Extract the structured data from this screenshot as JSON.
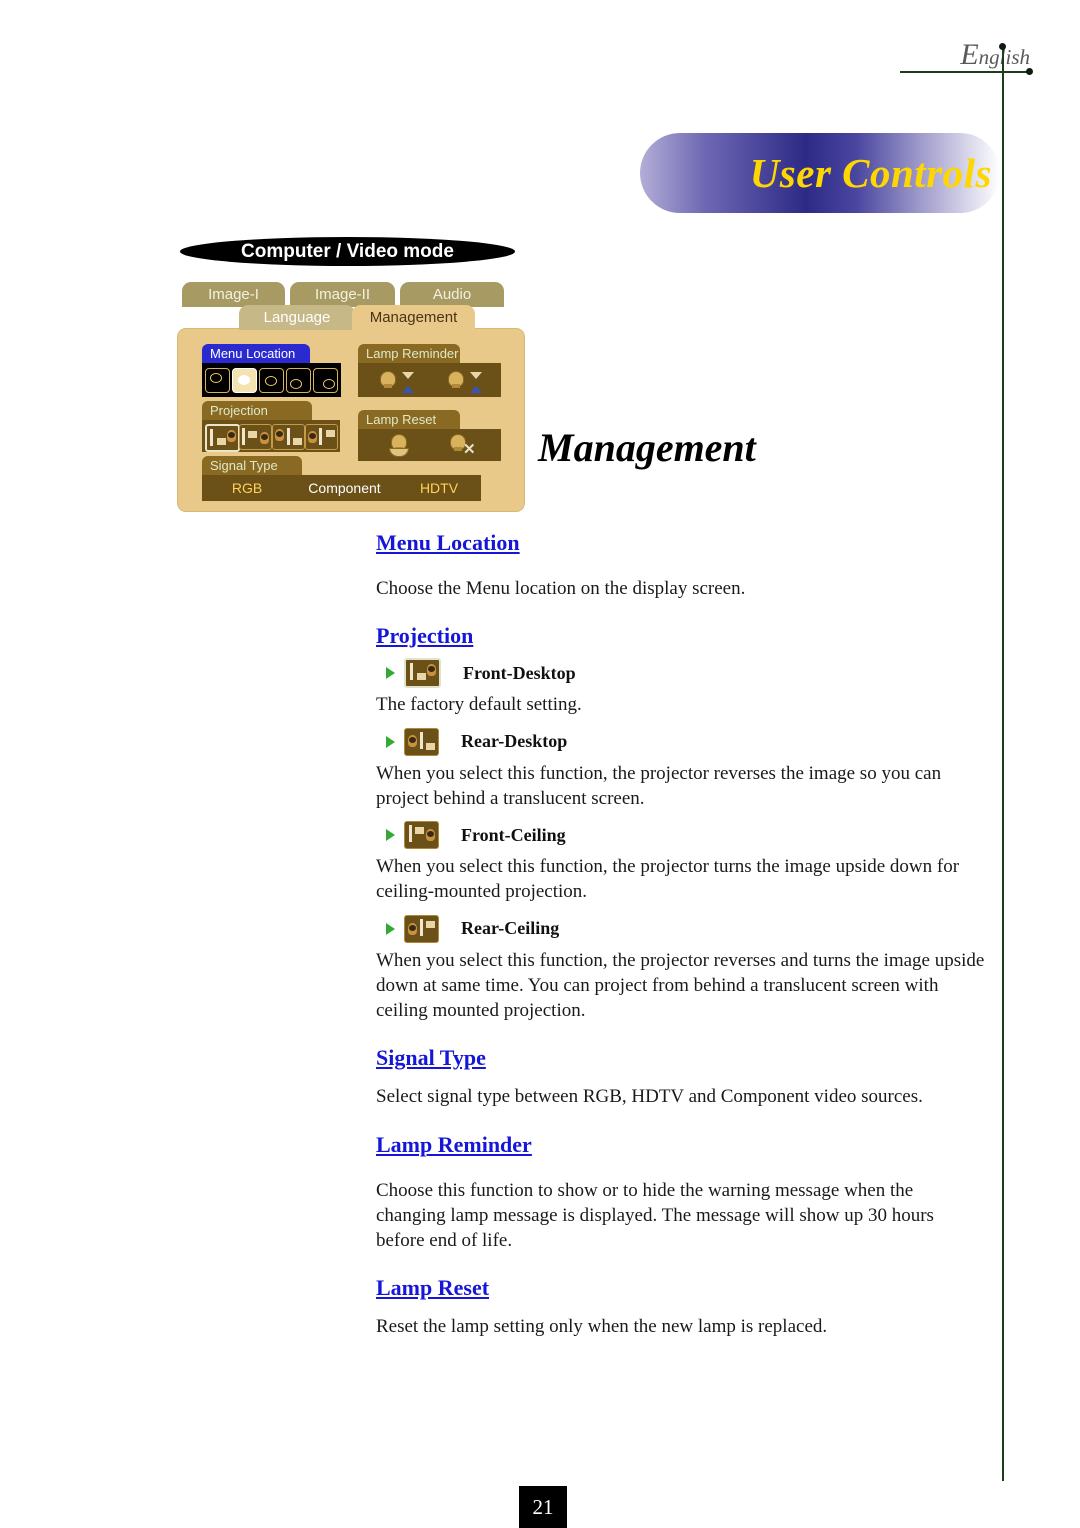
{
  "header": {
    "language_mark_big": "E",
    "language_mark_small": "nglish",
    "banner_title": "User Controls",
    "mode_banner": "Computer / Video mode"
  },
  "osd": {
    "tabs": [
      {
        "label": "Image-I",
        "state": "inactive"
      },
      {
        "label": "Image-II",
        "state": "inactive"
      },
      {
        "label": "Audio",
        "state": "inactive"
      },
      {
        "label": "Language",
        "state": "semi"
      },
      {
        "label": "Management",
        "state": "active"
      }
    ],
    "sections": {
      "menu_location": "Menu Location",
      "projection": "Projection",
      "signal_type": "Signal Type",
      "lamp_reminder": "Lamp Reminder",
      "lamp_reset": "Lamp Reset"
    },
    "signal_options": [
      {
        "label": "RGB",
        "selected": true
      },
      {
        "label": "Component",
        "selected": false
      },
      {
        "label": "HDTV",
        "selected": true
      }
    ]
  },
  "page_title": "Management",
  "sections": {
    "menu_location": {
      "heading": "Menu Location",
      "body": "Choose the Menu location on the display screen."
    },
    "projection": {
      "heading": "Projection",
      "options": [
        {
          "label": "Front-Desktop",
          "icon": "front-desktop-icon",
          "selected": true,
          "body": "The factory default setting."
        },
        {
          "label": "Rear-Desktop",
          "icon": "rear-desktop-icon",
          "selected": false,
          "body": "When you select this function, the projector reverses the image so you can project behind a translucent screen."
        },
        {
          "label": "Front-Ceiling",
          "icon": "front-ceiling-icon",
          "selected": false,
          "body": "When you select this function, the projector turns the image upside down for ceiling-mounted projection."
        },
        {
          "label": "Rear-Ceiling",
          "icon": "rear-ceiling-icon",
          "selected": false,
          "body": "When you select this function, the projector reverses and turns the image upside down at same time. You can project from  behind a translucent screen with ceiling mounted projection."
        }
      ]
    },
    "signal_type": {
      "heading": "Signal Type",
      "body": "Select signal type between RGB, HDTV and Component video sources."
    },
    "lamp_reminder": {
      "heading": "Lamp Reminder",
      "body": "Choose this function to show or to hide the warning message when the changing lamp message is displayed.  The message will show up 30 hours before end of life."
    },
    "lamp_reset": {
      "heading": "Lamp Reset",
      "body": "Reset the lamp setting only when the new lamp is replaced."
    }
  },
  "footer": {
    "page_number": "21"
  },
  "colors": {
    "heading_blue": "#1616d8",
    "banner_yellow": "#ffd700",
    "rule_green": "#1d3d1d",
    "osd_tan": "#e8c98a",
    "osd_brown": "#6b5118",
    "bullet_green": "#33aa33"
  }
}
